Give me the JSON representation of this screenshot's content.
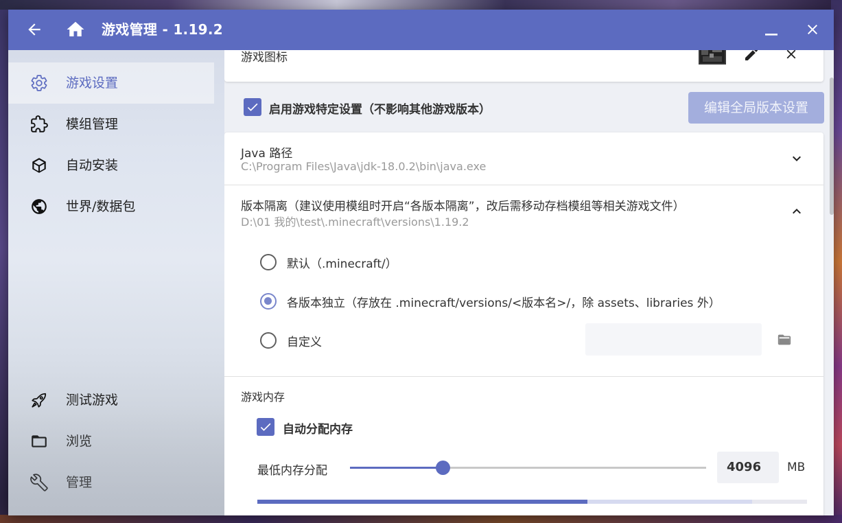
{
  "titlebar": {
    "title": "游戏管理 - 1.19.2",
    "back_icon": "arrow-left-icon",
    "home_icon": "home-icon",
    "minimize_icon": "minimize-icon",
    "close_icon": "close-icon"
  },
  "sidebar": {
    "items": [
      {
        "label": "游戏设置",
        "icon": "gear-icon",
        "active": true
      },
      {
        "label": "模组管理",
        "icon": "puzzle-icon"
      },
      {
        "label": "自动安装",
        "icon": "cube-icon"
      },
      {
        "label": "世界/数据包",
        "icon": "globe-icon"
      },
      {
        "label": "测试游戏",
        "icon": "rocket-icon"
      },
      {
        "label": "浏览",
        "icon": "folder-icon"
      },
      {
        "label": "管理",
        "icon": "wrench-icon"
      }
    ]
  },
  "icon_card": {
    "label": "游戏图标"
  },
  "special_settings": {
    "checkbox_label": "启用游戏特定设置（不影响其他游戏版本）",
    "checked": true,
    "global_button": "编辑全局版本设置"
  },
  "java": {
    "title": "Java 路径",
    "value": "C:\\Program Files\\Java\\jdk-18.0.2\\bin\\java.exe"
  },
  "isolation": {
    "title": "版本隔离（建议使用模组时开启“各版本隔离”，改后需移动存档模组等相关游戏文件）",
    "value": "D:\\01 我的\\test\\.minecraft\\versions\\1.19.2",
    "options": [
      {
        "label": "默认（.minecraft/）",
        "selected": false
      },
      {
        "label": "各版本独立（存放在 .minecraft/versions/<版本名>/，除 assets、libraries 外）",
        "selected": true
      },
      {
        "label": "自定义",
        "selected": false
      }
    ],
    "custom_path_value": ""
  },
  "memory": {
    "section_title": "游戏内存",
    "auto_label": "自动分配内存",
    "auto_checked": true,
    "min_label": "最低内存分配",
    "min_value": "4096",
    "unit": "MB",
    "slider_fraction": 0.26,
    "usage_fraction": 0.6,
    "allocated_fraction": 0.9
  },
  "colors": {
    "accent": "#5c6bc0",
    "accent_light": "#7986cb"
  }
}
